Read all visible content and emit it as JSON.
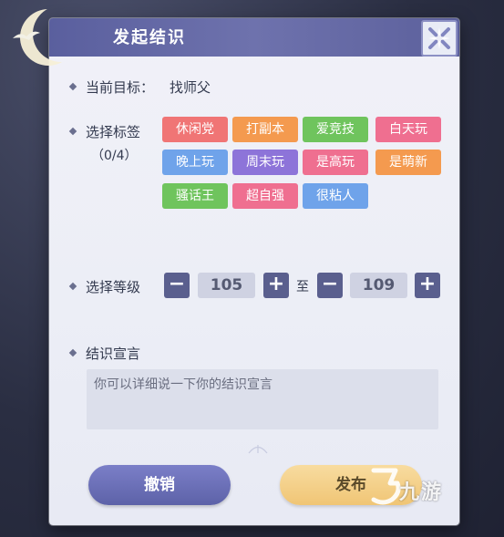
{
  "dialog": {
    "title": "发起结识",
    "close_icon": "close-x-icon"
  },
  "target": {
    "label": "当前目标：",
    "value": "找师父"
  },
  "tags": {
    "label": "选择标签",
    "count": "（0/4）",
    "items": [
      {
        "label": "休闲党",
        "color": "#f07575"
      },
      {
        "label": "打副本",
        "color": "#f49a4f"
      },
      {
        "label": "爱竞技",
        "color": "#6fc45d"
      },
      {
        "label": "白天玩",
        "color": "#ef6f90"
      },
      {
        "label": "晚上玩",
        "color": "#6fa3ea"
      },
      {
        "label": "周末玩",
        "color": "#8d74d9"
      },
      {
        "label": "是高玩",
        "color": "#ef6f90"
      },
      {
        "label": "是萌新",
        "color": "#f49a4f"
      },
      {
        "label": "骚话王",
        "color": "#6fc45d"
      },
      {
        "label": "超自强",
        "color": "#ef6f90"
      },
      {
        "label": "很粘人",
        "color": "#6fa3ea"
      }
    ]
  },
  "level": {
    "label": "选择等级",
    "min": "105",
    "max": "109",
    "to_text": "至",
    "minus_label": "−",
    "plus_label": "+"
  },
  "declaration": {
    "label": "结识宣言",
    "placeholder": "你可以详细说一下你的结识宣言"
  },
  "buttons": {
    "cancel": "撤销",
    "publish": "发布"
  },
  "watermark": {
    "text": "九游",
    "icon": "nine-game-logo-icon"
  }
}
